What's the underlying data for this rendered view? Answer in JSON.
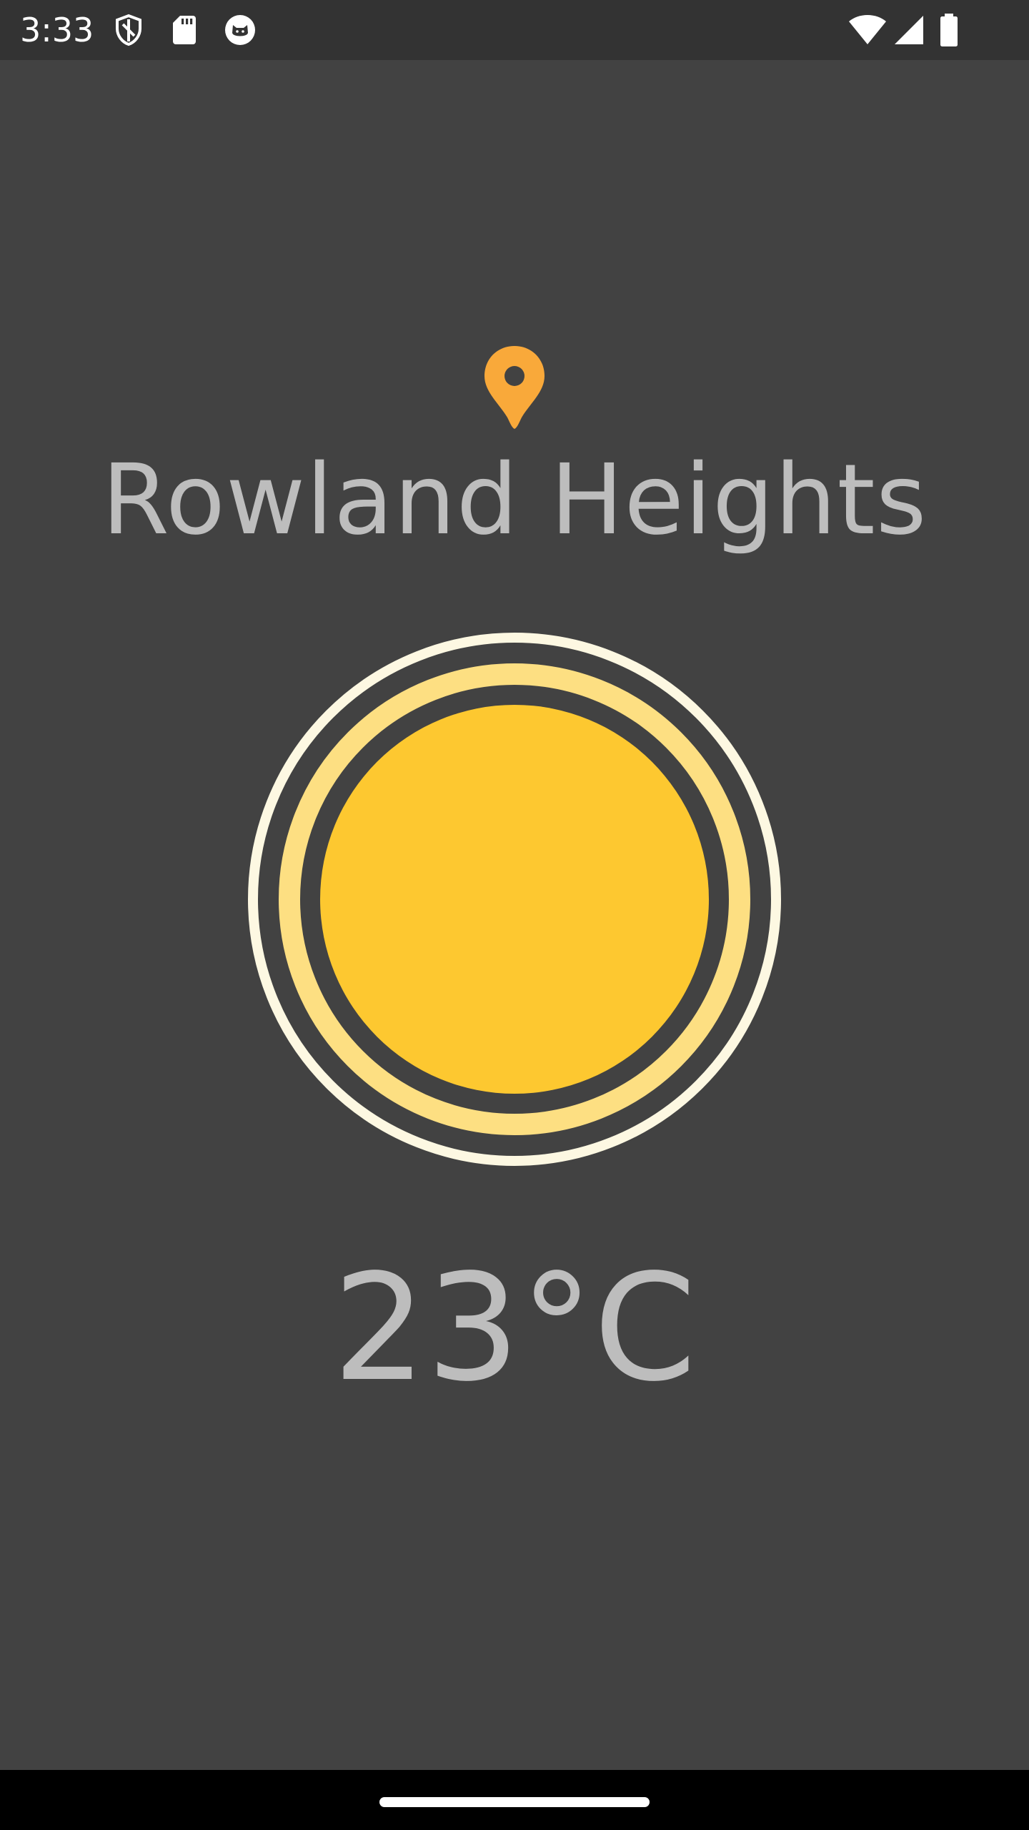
{
  "status_bar": {
    "time": "3:33",
    "left_icons": [
      "shield-icon",
      "sd-card-icon",
      "cat-face-icon"
    ],
    "right_icons": [
      "wifi-icon",
      "cellular-signal-icon",
      "battery-icon"
    ]
  },
  "weather": {
    "location_icon": "location-pin-icon",
    "city": "Rowland Heights",
    "condition_icon": "sun-icon",
    "temperature": "23°C"
  },
  "colors": {
    "background": "#424242",
    "status_bar": "#333333",
    "text": "#bdbdbd",
    "pin": "#f9a93a",
    "sun_core": "#fdc830",
    "sun_inner_ring": "#fddf82",
    "sun_outer_ring": "#fdf8e2"
  },
  "nav_bar": {
    "handle_icon": "home-handle-icon"
  }
}
